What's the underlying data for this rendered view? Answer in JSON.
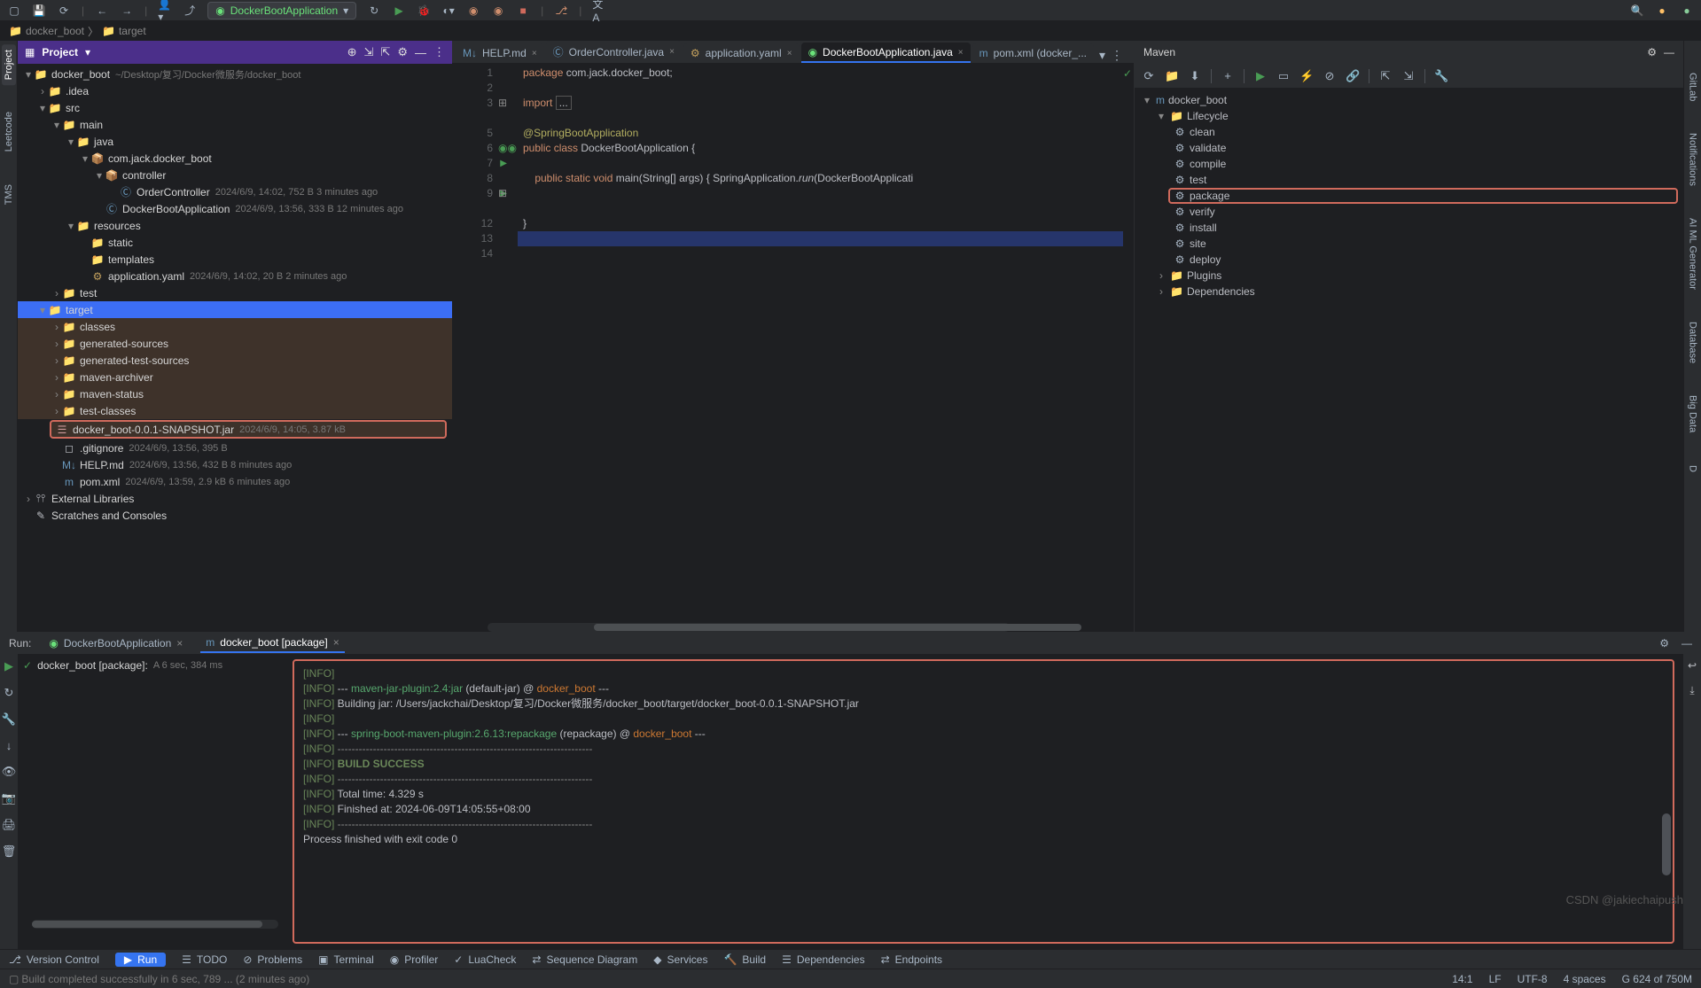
{
  "topbar": {
    "run_config": "DockerBootApplication"
  },
  "breadcrumb": {
    "root": "docker_boot",
    "path": "target"
  },
  "project_panel": {
    "title": "Project",
    "root_name": "docker_boot",
    "root_path": "~/Desktop/复习/Docker微服务/docker_boot",
    "idea": ".idea",
    "src": "src",
    "main": "main",
    "java": "java",
    "pkg": "com.jack.docker_boot",
    "controller": "controller",
    "order_ctrl": "OrderController",
    "order_ctrl_meta": "2024/6/9, 14:02, 752 B 3 minutes ago",
    "app_class": "DockerBootApplication",
    "app_class_meta": "2024/6/9, 13:56, 333 B 12 minutes ago",
    "resources": "resources",
    "static": "static",
    "templates": "templates",
    "app_yaml": "application.yaml",
    "app_yaml_meta": "2024/6/9, 14:02, 20 B 2 minutes ago",
    "test": "test",
    "target": "target",
    "classes": "classes",
    "gen_src": "generated-sources",
    "gen_test_src": "generated-test-sources",
    "maven_arch": "maven-archiver",
    "maven_status": "maven-status",
    "test_classes": "test-classes",
    "jar": "docker_boot-0.0.1-SNAPSHOT.jar",
    "jar_meta": "2024/6/9, 14:05, 3.87 kB",
    "gitignore": ".gitignore",
    "gitignore_meta": "2024/6/9, 13:56, 395 B",
    "help": "HELP.md",
    "help_meta": "2024/6/9, 13:56, 432 B 8 minutes ago",
    "pom": "pom.xml",
    "pom_meta": "2024/6/9, 13:59, 2.9 kB 6 minutes ago",
    "ext_lib": "External Libraries",
    "scratches": "Scratches and Consoles"
  },
  "editor_tabs": {
    "t1": "HELP.md",
    "t2": "OrderController.java",
    "t3": "application.yaml",
    "t4": "DockerBootApplication.java",
    "t5": "pom.xml (docker_..."
  },
  "code": {
    "l1": "package com.jack.docker_boot;",
    "l3": "import ...",
    "l6": "@SpringBootApplication",
    "l7a": "public class ",
    "l7b": "DockerBootApplication {",
    "l9a": "    public static void ",
    "l9b": "main",
    "l9c": "(String[] args) { SpringApplication.",
    "l9d": "run",
    "l9e": "(DockerBootApplicati",
    "l13": "}"
  },
  "line_numbers": [
    "1",
    "2",
    "3",
    "",
    "5",
    "6",
    "7",
    "8",
    "9",
    "",
    "12",
    "13",
    "14"
  ],
  "maven": {
    "title": "Maven",
    "root": "docker_boot",
    "lifecycle": "Lifecycle",
    "phases": [
      "clean",
      "validate",
      "compile",
      "test",
      "package",
      "verify",
      "install",
      "site",
      "deploy"
    ],
    "plugins": "Plugins",
    "deps": "Dependencies"
  },
  "run": {
    "title": "Run:",
    "tab1": "DockerBootApplication",
    "tab2": "docker_boot [package]",
    "tree_node": "docker_boot [package]:",
    "tree_time": "A 6 sec, 384 ms",
    "console": [
      {
        "t": "[INFO]",
        "r": ""
      },
      {
        "t": "[INFO]",
        "r": " --- ",
        "p": "maven-jar-plugin:2.4:jar",
        "r2": " (default-jar) @ ",
        "m": "docker_boot",
        "r3": " ---"
      },
      {
        "t": "[INFO]",
        "r": " Building jar: /Users/jackchai/Desktop/复习/Docker微服务/docker_boot/target/docker_boot-0.0.1-SNAPSHOT.jar"
      },
      {
        "t": "[INFO]",
        "r": ""
      },
      {
        "t": "[INFO]",
        "r": " --- ",
        "p": "spring-boot-maven-plugin:2.6.13:repackage",
        "r2": " (repackage) @ ",
        "m": "docker_boot",
        "r3": " ---"
      },
      {
        "t": "[INFO]",
        "d": " ------------------------------------------------------------------------"
      },
      {
        "t": "[INFO]",
        "s": " BUILD SUCCESS"
      },
      {
        "t": "[INFO]",
        "d": " ------------------------------------------------------------------------"
      },
      {
        "t": "[INFO]",
        "r": " Total time:  4.329 s"
      },
      {
        "t": "[INFO]",
        "r": " Finished at: 2024-06-09T14:05:55+08:00"
      },
      {
        "t": "[INFO]",
        "d": " ------------------------------------------------------------------------"
      },
      {
        "plain": ""
      },
      {
        "plain": "Process finished with exit code 0"
      }
    ]
  },
  "statusbar": {
    "vcs": "Version Control",
    "run": "Run",
    "todo": "TODO",
    "problems": "Problems",
    "terminal": "Terminal",
    "profiler": "Profiler",
    "luacheck": "LuaCheck",
    "seqdiag": "Sequence Diagram",
    "services": "Services",
    "build": "Build",
    "deps": "Dependencies",
    "endpoints": "Endpoints"
  },
  "statusbar2": {
    "msg": "Build completed successfully in 6 sec, 789 ... (2 minutes ago)",
    "pos": "14:1",
    "lf": "LF",
    "enc": "UTF-8",
    "indent": "4 spaces",
    "gc": "G 624 of 750M"
  },
  "watermark": "CSDN @jakiechaipush",
  "left_tabs": {
    "project": "Project",
    "leetcode": "Leetcode",
    "tms": "TMS"
  },
  "right_tabs": {
    "gitlab": "GitLab",
    "notif": "Notifications",
    "aigen": "AI ML Generator",
    "db": "Database",
    "bigdata": "Big Data",
    "d": "D"
  }
}
